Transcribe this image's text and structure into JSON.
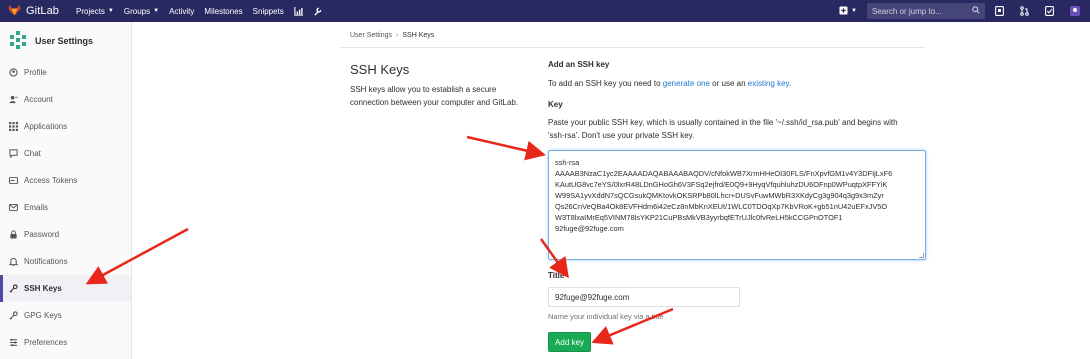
{
  "topbar": {
    "brand": "GitLab",
    "nav": [
      "Projects",
      "Groups",
      "Activity",
      "Milestones",
      "Snippets"
    ],
    "search_placeholder": "Search or jump to..."
  },
  "sidebar": {
    "title": "User Settings",
    "items": [
      {
        "label": "Profile",
        "icon": "profile-icon"
      },
      {
        "label": "Account",
        "icon": "account-icon"
      },
      {
        "label": "Applications",
        "icon": "applications-icon"
      },
      {
        "label": "Chat",
        "icon": "chat-icon"
      },
      {
        "label": "Access Tokens",
        "icon": "token-icon"
      },
      {
        "label": "Emails",
        "icon": "email-icon"
      },
      {
        "label": "Password",
        "icon": "lock-icon"
      },
      {
        "label": "Notifications",
        "icon": "bell-icon"
      },
      {
        "label": "SSH Keys",
        "icon": "key-icon"
      },
      {
        "label": "GPG Keys",
        "icon": "key-icon"
      },
      {
        "label": "Preferences",
        "icon": "preferences-icon"
      }
    ],
    "active": "SSH Keys"
  },
  "breadcrumb": {
    "parent": "User Settings",
    "current": "SSH Keys",
    "separator": "›"
  },
  "page": {
    "title": "SSH Keys",
    "description": "SSH keys allow you to establish a secure connection between your computer and GitLab."
  },
  "form": {
    "add_heading": "Add an SSH key",
    "add_intro_prefix": "To add an SSH key you need to",
    "generate_link": "generate one",
    "add_intro_mid": "or use an",
    "existing_link": "existing key",
    "add_intro_suffix": ".",
    "key_label": "Key",
    "key_help_line1": "Paste your public SSH key, which is usually contained in the file '~/.ssh/id_rsa.pub' and begins with",
    "key_help_line2": "'ssh-rsa'. Don't use your private SSH key.",
    "key_lines": [
      "ssh-rsa",
      "AAAAB3NzaC1yc2EAAAADAQABAAABAQDV/cNfokWB7XrmHHeOI30FLS/FnXpvfGM1v4Y3DFIjLxF6",
      "KAutUG8vc7eYS/0lxrR48LDnGHoGh6V3FSq2ejfrd/E0Q9+9HyqVfquhluhzDU6OFnp0WPuqtpXFFYiK",
      "W99SA1yvXddN7sQCGsukQMKtovkOKSRPb80lLhcr+DUSvFuwMWbR3XKdyCg3g904q3g9x3mZyr",
      "Qs26CnVeQBa4Ok8EVFHdm6i42eCz8nMbKnXEUt/1WLC0TDOqXp7KbVRoK+gb51nU42uEFxJV5O",
      "W3T8lxaIMrEq5VINM78lsYKP21CuPBsMkVB3yyrbqfETrUJlc0fvReLH5kCCGPnOTOF1",
      "92fuge@92fuge.com"
    ],
    "title_label": "Title",
    "title_value": "92fuge@92fuge.com",
    "title_hint": "Name your individual key via a title",
    "submit": "Add key"
  },
  "colors": {
    "topbar": "#292961",
    "accent": "#1f78d1",
    "button": "#1aaa55",
    "arrow": "#e8261a"
  }
}
